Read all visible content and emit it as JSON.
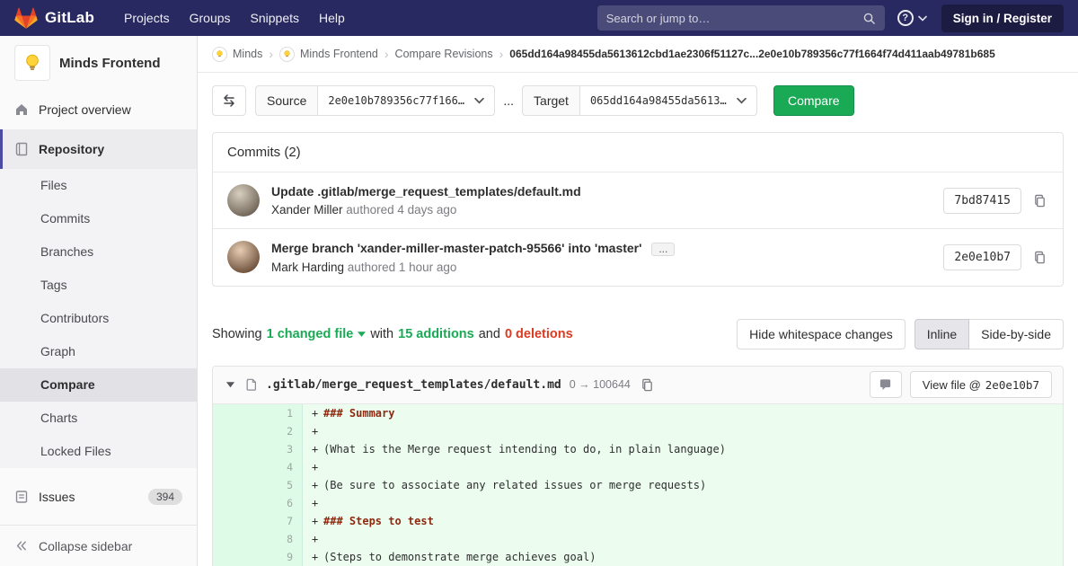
{
  "navbar": {
    "logo_text": "GitLab",
    "links": [
      "Projects",
      "Groups",
      "Snippets",
      "Help"
    ],
    "search_placeholder": "Search or jump to…",
    "help_icon": "?",
    "sign_in_label": "Sign in / Register"
  },
  "sidebar": {
    "project_name": "Minds Frontend",
    "project_overview": "Project overview",
    "repository": "Repository",
    "repo_items": [
      "Files",
      "Commits",
      "Branches",
      "Tags",
      "Contributors",
      "Graph",
      "Compare",
      "Charts",
      "Locked Files"
    ],
    "issues_label": "Issues",
    "issues_count": "394",
    "collapse_label": "Collapse sidebar"
  },
  "breadcrumb": {
    "group": "Minds",
    "project": "Minds Frontend",
    "page": "Compare Revisions",
    "separator": "›",
    "sha_range": "065dd164a98455da5613612cbd1ae2306f51127c...2e0e10b789356c77f1664f74d411aab49781b685"
  },
  "compare_form": {
    "source_label": "Source",
    "source_value": "2e0e10b789356c77f166…",
    "separator": "...",
    "target_label": "Target",
    "target_value": "065dd164a98455da5613…",
    "compare_button": "Compare"
  },
  "commits": {
    "title": "Commits (2)",
    "items": [
      {
        "title": "Update .gitlab/merge_request_templates/default.md",
        "author": "Xander Miller",
        "meta": "authored 4 days ago",
        "sha": "7bd87415"
      },
      {
        "title": "Merge branch 'xander-miller-master-patch-95566' into 'master'",
        "expand": "...",
        "author": "Mark Harding",
        "meta": "authored 1 hour ago",
        "sha": "2e0e10b7"
      }
    ]
  },
  "diff_summary": {
    "showing": "Showing",
    "changed_files": "1 changed file",
    "with_text": "with",
    "additions": "15 additions",
    "and_text": "and",
    "deletions": "0 deletions",
    "hide_whitespace": "Hide whitespace changes",
    "inline": "Inline",
    "side_by_side": "Side-by-side"
  },
  "diff_file": {
    "path": ".gitlab/merge_request_templates/default.md",
    "mode_change": "0 → 100644",
    "view_file_label": "View file @",
    "view_file_sha": "2e0e10b7",
    "plus": "+",
    "lines": [
      {
        "n": "1",
        "text": "### Summary"
      },
      {
        "n": "2",
        "text": ""
      },
      {
        "n": "3",
        "text": "(What is the Merge request intending to do, in plain language)"
      },
      {
        "n": "4",
        "text": ""
      },
      {
        "n": "5",
        "text": "(Be sure to associate any related issues or merge requests)"
      },
      {
        "n": "6",
        "text": ""
      },
      {
        "n": "7",
        "text": "### Steps to test"
      },
      {
        "n": "8",
        "text": ""
      },
      {
        "n": "9",
        "text": "(Steps to demonstrate merge achieves goal)"
      }
    ]
  },
  "colors": {
    "navbar_bg": "#292961",
    "accent_indigo": "#4b4ba3",
    "green": "#1aaa55",
    "red": "#db3b21",
    "added_line_bg": "#ecfdf0",
    "added_gutter_bg": "#ddfbe6"
  }
}
